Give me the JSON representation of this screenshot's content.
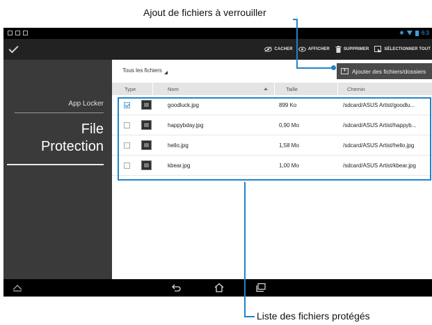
{
  "callouts": {
    "top": "Ajout de fichiers à verrouiller",
    "bottom": "Liste des fichiers protégés"
  },
  "status_bar": {
    "time": "6:3"
  },
  "action_bar": {
    "hide": "CACHER",
    "show": "AFFICHER",
    "delete": "SUPPRIMER",
    "select_all": "SÉLECTIONNER TOUT"
  },
  "sidebar": {
    "app_label": "App Locker",
    "title_line1": "File",
    "title_line2": "Protection"
  },
  "filter": {
    "label": "Tous les fichiers"
  },
  "add_button": {
    "label": "Ajouter des fichiers/dossiers"
  },
  "table": {
    "headers": {
      "type": "Type",
      "name": "Nom",
      "size": "Taille",
      "path": "Chemin"
    },
    "rows": [
      {
        "name": "goodluck.jpg",
        "size": "899 Ko",
        "path": "/sdcard/ASUS Artist/goodlu...",
        "checked": true
      },
      {
        "name": "happybday.jpg",
        "size": "0,90 Mo",
        "path": "/sdcard/ASUS Artist/happyb...",
        "checked": false
      },
      {
        "name": "hello.jpg",
        "size": "1,58 Mo",
        "path": "/sdcard/ASUS Artist/hello.jpg",
        "checked": false
      },
      {
        "name": "kbear.jpg",
        "size": "1,00 Mo",
        "path": "/sdcard/ASUS Artist/kbear.jpg",
        "checked": false
      }
    ]
  },
  "colors": {
    "accent": "#1f84c9",
    "sidebar": "#3a3a3a",
    "toolbar": "#222222",
    "header_row": "#e4e4e4"
  },
  "icons": [
    "hide-icon",
    "show-icon",
    "trash-icon",
    "select-all-icon",
    "add-files-icon",
    "back-icon",
    "home-icon",
    "recent-apps-icon"
  ]
}
